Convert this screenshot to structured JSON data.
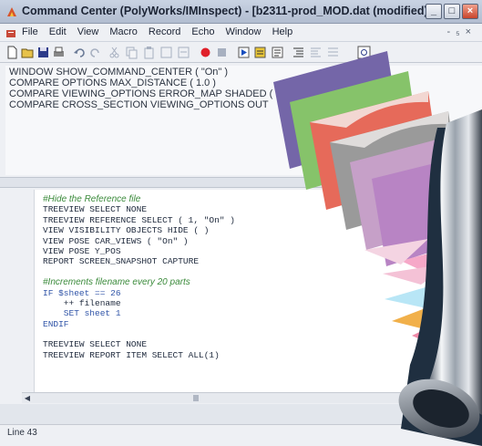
{
  "window": {
    "title": "Command Center (PolyWorks/IMInspect) - [b2311-prod_MOD.dat (modified)]"
  },
  "menubar": {
    "items": [
      "File",
      "Edit",
      "View",
      "Macro",
      "Record",
      "Echo",
      "Window",
      "Help"
    ]
  },
  "console": {
    "lines": [
      "WINDOW SHOW_COMMAND_CENTER ( \"On\" )",
      "COMPARE OPTIONS MAX_DISTANCE ( 1.0 )",
      "COMPARE VIEWING_OPTIONS ERROR_MAP SHADED ( \"O",
      "COMPARE CROSS_SECTION VIEWING_OPTIONS OUT"
    ]
  },
  "editor": {
    "comment_hide": "#Hide the Reference file",
    "line_treeview_select_none": "TREEVIEW SELECT NONE",
    "line_treeview_reference": "TREEVIEW REFERENCE SELECT ( 1, \"On\" )",
    "line_view_visibility": "VIEW VISIBILITY OBJECTS HIDE ( )",
    "line_view_pose_car": "VIEW POSE CAR_VIEWS ( \"On\" )",
    "line_view_pose_ypos": "VIEW POSE Y_POS",
    "line_report_snapshot": "REPORT SCREEN_SNAPSHOT CAPTURE",
    "comment_increments": "#Increments filename every 20 parts",
    "line_if": "IF $sheet == 26",
    "line_filename": "    ++ filename",
    "line_set_sheet": "    SET sheet 1",
    "line_endif": "ENDIF",
    "line_treeview_select_none_2": "TREEVIEW SELECT NONE",
    "line_treeview_report": "TREEVIEW REPORT ITEM SELECT ALL(1)"
  },
  "status": {
    "text": "Line 43"
  },
  "colors": {
    "titlebar": "#b9c4d6",
    "comment": "#3a8a3a",
    "keyword": "#3155a8",
    "record_button": "#e0202a"
  },
  "icons": [
    "new-file-icon",
    "open-folder-icon",
    "save-icon",
    "print-icon",
    "undo-icon",
    "redo-icon",
    "cut-icon",
    "copy-icon",
    "paste-icon",
    "record-icon",
    "stop-icon",
    "run-icon"
  ]
}
